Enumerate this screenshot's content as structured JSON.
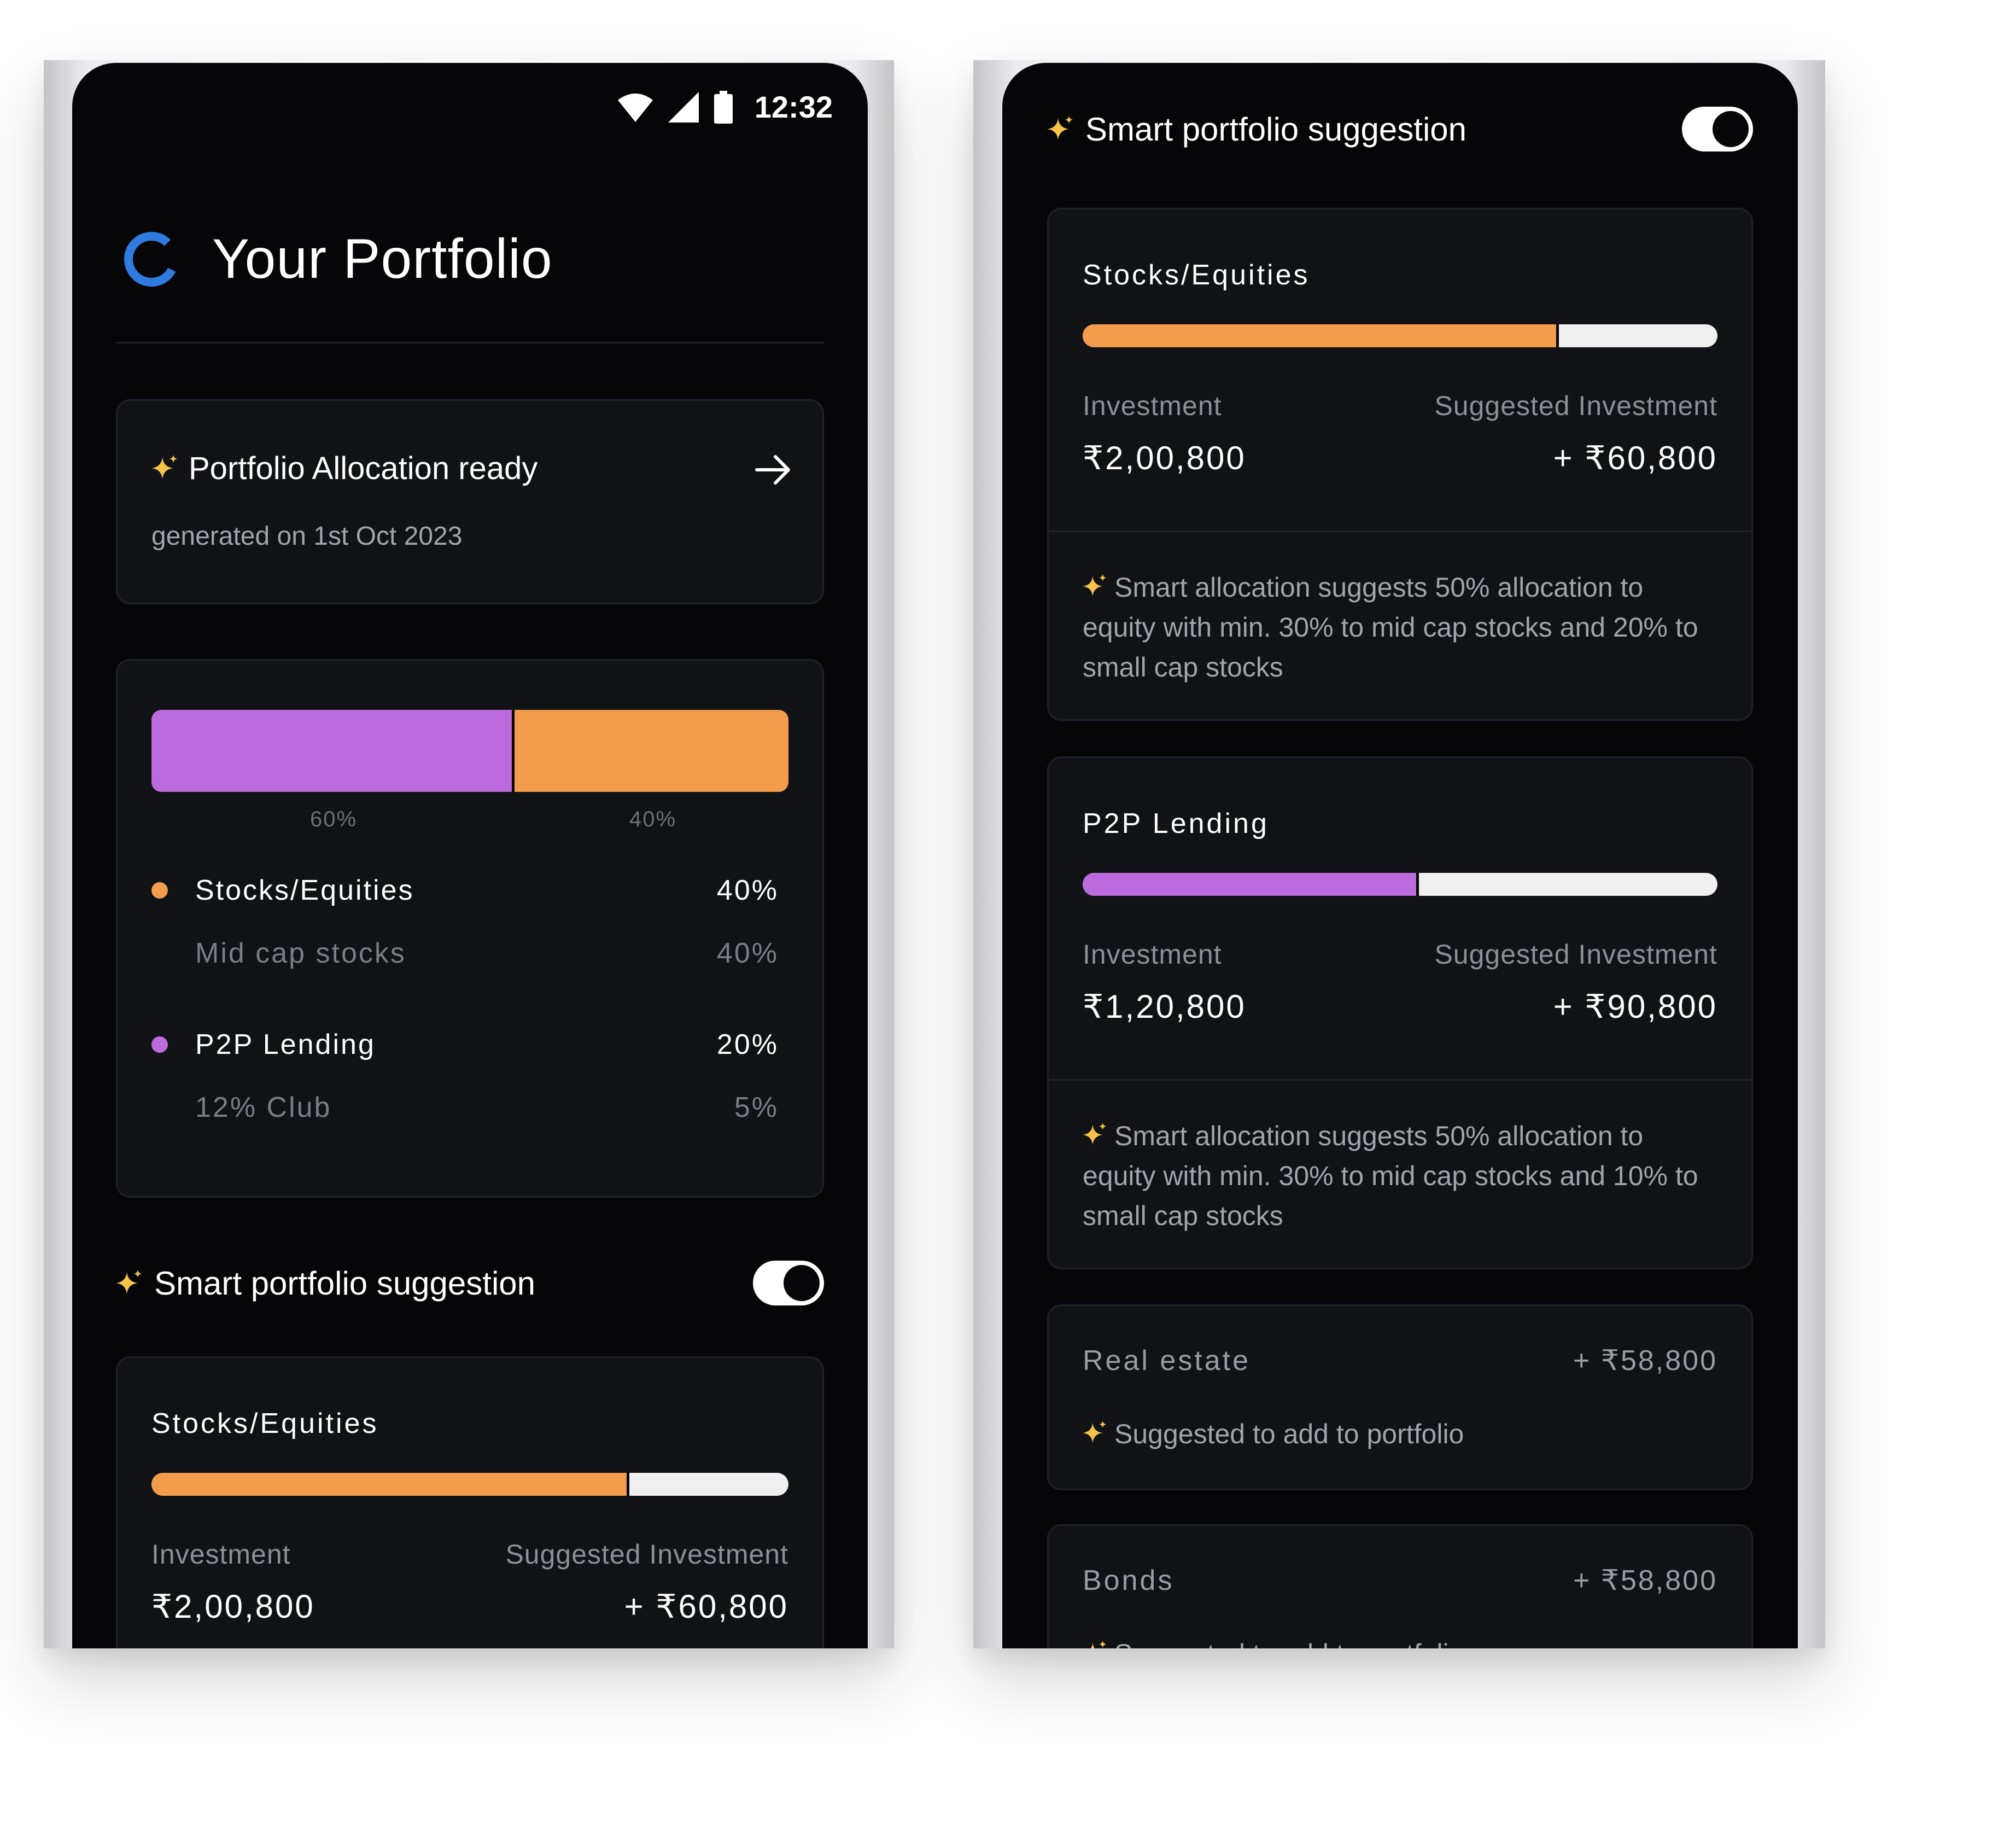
{
  "left_screen": {
    "status": {
      "time": "12:32"
    },
    "header": {
      "title": "Your Portfolio"
    },
    "allocation_card": {
      "title": "Portfolio Allocation ready",
      "subtitle": "generated on 1st Oct 2023"
    },
    "breakdown": {
      "bar": [
        {
          "label": "60%",
          "fraction": 0.57,
          "color": "#bc6bdc"
        },
        {
          "label": "40%",
          "fraction": 0.43,
          "color": "#f39c4c"
        }
      ],
      "items": [
        {
          "name": "Stocks/Equities",
          "value": "40%",
          "color": "#f39c4c",
          "sub": {
            "name": "Mid cap stocks",
            "value": "40%"
          }
        },
        {
          "name": "P2P Lending",
          "value": "20%",
          "color": "#bc6bdc",
          "sub": {
            "name": "12% Club",
            "value": "5%"
          }
        }
      ]
    },
    "smart": {
      "label": "Smart portfolio suggestion",
      "enabled": true
    },
    "asset": {
      "name": "Stocks/Equities",
      "fraction": 0.75,
      "color": "#f39c4c",
      "investment_label": "Investment",
      "investment": "₹2,00,800",
      "suggested_label": "Suggested Investment",
      "suggested": "+ ₹60,800"
    }
  },
  "right_screen": {
    "smart": {
      "label": "Smart portfolio suggestion",
      "enabled": true
    },
    "assets": [
      {
        "name": "Stocks/Equities",
        "fraction": 0.75,
        "color": "#f39c4c",
        "investment_label": "Investment",
        "investment": "₹2,00,800",
        "suggested_label": "Suggested Investment",
        "suggested": "+ ₹60,800",
        "note": "Smart allocation suggests 50% allocation to equity with min. 30% to mid cap stocks and 20% to small cap stocks"
      },
      {
        "name": "P2P Lending",
        "fraction": 0.53,
        "color": "#bc6bdc",
        "investment_label": "Investment",
        "investment": "₹1,20,800",
        "suggested_label": "Suggested Investment",
        "suggested": "+ ₹90,800",
        "note": "Smart allocation suggests 50% allocation to equity with min. 30% to mid cap stocks and 10% to small cap stocks"
      }
    ],
    "extras": [
      {
        "name": "Real estate",
        "value": "+ ₹58,800",
        "note": "Suggested to add to portfolio"
      },
      {
        "name": "Bonds",
        "value": "+ ₹58,800",
        "note": "Suggested to add to portfolio"
      }
    ]
  },
  "icons": {
    "sparkle": "sparkle-icon",
    "arrow": "arrow-right-icon",
    "logo": "portfolio-ring-icon",
    "wifi": "wifi-icon",
    "signal": "signal-icon",
    "battery": "battery-icon"
  }
}
